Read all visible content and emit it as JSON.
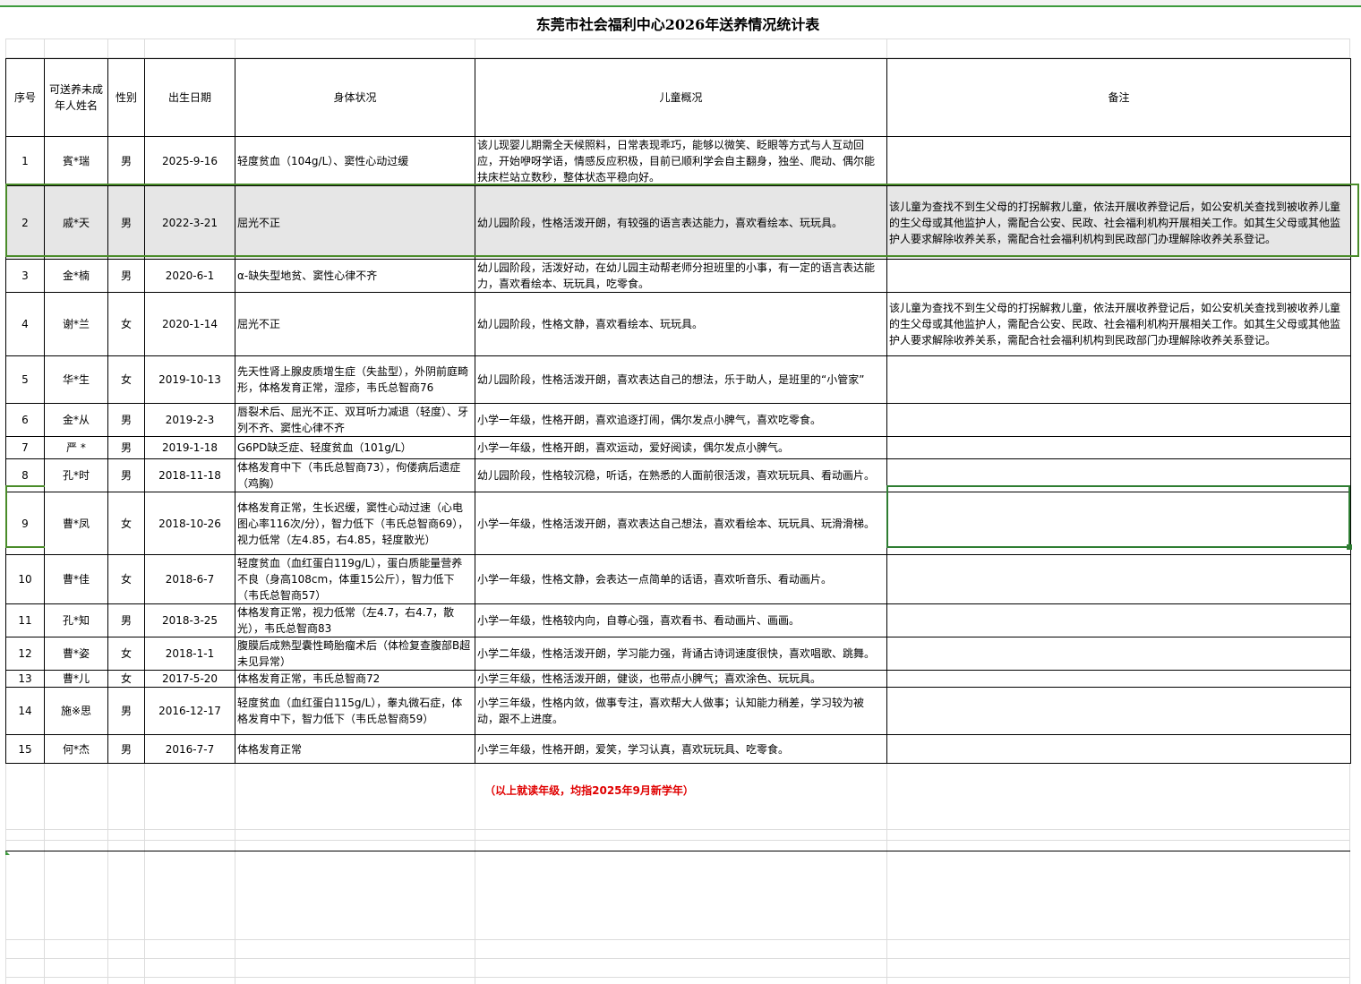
{
  "title": "东莞市社会福利中心2026年送养情况统计表",
  "headers": {
    "no": "序号",
    "name": "可送养未成年人姓名",
    "gender": "性别",
    "birth": "出生日期",
    "health": "身体状况",
    "overview": "儿童概况",
    "remark": "备注"
  },
  "rows": [
    {
      "no": "1",
      "name": "賓*瑞",
      "gender": "男",
      "birth": "2025-9-16",
      "health": "轻度贫血（104g/L）、窦性心动过缓",
      "overview": "该儿现婴儿期需全天候照料，日常表现乖巧，能够以微笑、眨眼等方式与人互动回应，开始咿呀学语，情感反应积极，目前已顺利学会自主翻身，独坐、爬动、偶尔能扶床栏站立数秒，整体状态平稳向好。",
      "remark": ""
    },
    {
      "no": "2",
      "name": "戚*天",
      "gender": "男",
      "birth": "2022-3-21",
      "health": "屈光不正",
      "overview": "幼儿园阶段，性格活泼开朗，有较强的语言表达能力，喜欢看绘本、玩玩具。",
      "remark": "该儿童为查找不到生父母的打拐解救儿童，依法开展收养登记后，如公安机关查找到被收养儿童的生父母或其他监护人，需配合公安、民政、社会福利机构开展相关工作。如其生父母或其他监护人要求解除收养关系，需配合社会福利机构到民政部门办理解除收养关系登记。"
    },
    {
      "no": "3",
      "name": "金*楠",
      "gender": "男",
      "birth": "2020-6-1",
      "health": "α-缺失型地贫、窦性心律不齐",
      "overview": "幼儿园阶段，活泼好动，在幼儿园主动帮老师分担班里的小事，有一定的语言表达能力，喜欢看绘本、玩玩具，吃零食。",
      "remark": ""
    },
    {
      "no": "4",
      "name": "谢*兰",
      "gender": "女",
      "birth": "2020-1-14",
      "health": "屈光不正",
      "overview": "幼儿园阶段，性格文静，喜欢看绘本、玩玩具。",
      "remark": "该儿童为查找不到生父母的打拐解救儿童，依法开展收养登记后，如公安机关查找到被收养儿童的生父母或其他监护人，需配合公安、民政、社会福利机构开展相关工作。如其生父母或其他监护人要求解除收养关系，需配合社会福利机构到民政部门办理解除收养关系登记。"
    },
    {
      "no": "5",
      "name": "华*生",
      "gender": "女",
      "birth": "2019-10-13",
      "health": "先天性肾上腺皮质增生症（失盐型），外阴前庭畸形，体格发育正常，湿疹，韦氏总智商76",
      "overview": "幼儿园阶段，性格活泼开朗，喜欢表达自己的想法，乐于助人，是班里的“小管家”",
      "remark": ""
    },
    {
      "no": "6",
      "name": "金*从",
      "gender": "男",
      "birth": "2019-2-3",
      "health": "唇裂术后、屈光不正、双耳听力减退（轻度）、牙列不齐、窦性心律不齐",
      "overview": "小学一年级，性格开朗，喜欢追逐打闹，偶尔发点小脾气，喜欢吃零食。",
      "remark": ""
    },
    {
      "no": "7",
      "name": "严 *",
      "gender": "男",
      "birth": "2019-1-18",
      "health": "G6PD缺乏症、轻度贫血（101g/L）",
      "overview": "小学一年级，性格开朗，喜欢运动，爱好阅读，偶尔发点小脾气。",
      "remark": ""
    },
    {
      "no": "8",
      "name": "孔*时",
      "gender": "男",
      "birth": "2018-11-18",
      "health": "体格发育中下（韦氏总智商73），佝偻病后遗症（鸡胸）",
      "overview": "幼儿园阶段，性格较沉稳，听话，在熟悉的人面前很活泼，喜欢玩玩具、看动画片。",
      "remark": ""
    },
    {
      "no": "9",
      "name": "曹*凤",
      "gender": "女",
      "birth": "2018-10-26",
      "health": "体格发育正常，生长迟缓，窦性心动过速（心电图心率116次/分），智力低下（韦氏总智商69），视力低常（左4.85，右4.85，轻度散光）",
      "overview": "小学一年级，性格活泼开朗，喜欢表达自己想法，喜欢看绘本、玩玩具、玩滑滑梯。",
      "remark": ""
    },
    {
      "no": "10",
      "name": "曹*佳",
      "gender": "女",
      "birth": "2018-6-7",
      "health": "轻度贫血（血红蛋白119g/L），蛋白质能量营养不良（身高108cm，体重15公斤），智力低下（韦氏总智商57）",
      "overview": "小学一年级，性格文静，会表达一点简单的话语，喜欢听音乐、看动画片。",
      "remark": ""
    },
    {
      "no": "11",
      "name": "孔*知",
      "gender": "男",
      "birth": "2018-3-25",
      "health": "体格发育正常，视力低常（左4.7，右4.7，散光），韦氏总智商83",
      "overview": "小学一年级，性格较内向，自尊心强，喜欢看书、看动画片、画画。",
      "remark": ""
    },
    {
      "no": "12",
      "name": "曹*姿",
      "gender": "女",
      "birth": "2018-1-1",
      "health": "腹膜后成熟型囊性畸胎瘤术后（体检复查腹部B超未见异常）",
      "overview": "小学二年级，性格活泼开朗，学习能力强，背诵古诗词速度很快，喜欢唱歌、跳舞。",
      "remark": ""
    },
    {
      "no": "13",
      "name": "曹*儿",
      "gender": "女",
      "birth": "2017-5-20",
      "health": "体格发育正常，韦氏总智商72",
      "overview": "小学三年级，性格活泼开朗，健谈，也带点小脾气；喜欢涂色、玩玩具。",
      "remark": ""
    },
    {
      "no": "14",
      "name": "施※思",
      "gender": "男",
      "birth": "2016-12-17",
      "health": "轻度贫血（血红蛋白115g/L），睾丸微石症，体格发育中下，智力低下（韦氏总智商59）",
      "overview": "小学三年级，性格内敛，做事专注，喜欢帮大人做事；认知能力稍差，学习较为被动，跟不上进度。",
      "remark": ""
    },
    {
      "no": "15",
      "name": "何*杰",
      "gender": "男",
      "birth": "2016-7-7",
      "health": "体格发育正常",
      "overview": "小学三年级，性格开朗，爱笑，学习认真，喜欢玩玩具、吃零食。",
      "remark": ""
    }
  ],
  "footnote": "（以上就读年级，均指2025年9月新学年）",
  "colors": {
    "selection": "#4a8c2a",
    "footnote": "#e00000",
    "highlight_row": "#e6e6e6"
  }
}
